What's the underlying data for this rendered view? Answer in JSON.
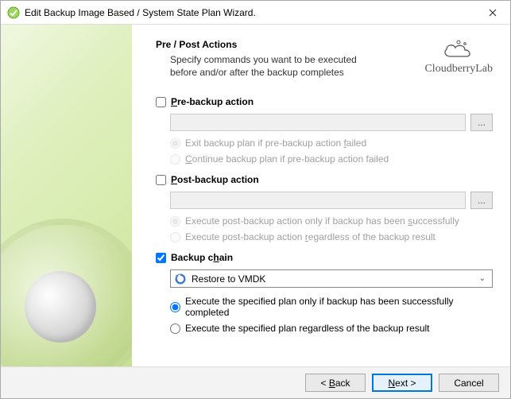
{
  "window": {
    "title": "Edit Backup Image Based / System State Plan Wizard."
  },
  "brand": "CloudberryLab",
  "header": {
    "title": "Pre / Post Actions",
    "subtitle": "Specify commands you want to be executed before and/or after the backup completes"
  },
  "prebackup": {
    "label_pre": "P",
    "label_post": "re-backup action",
    "exit_pre": "Exit backup plan if pre-backup action ",
    "exit_u": "f",
    "exit_post": "ailed",
    "cont_u": "C",
    "cont_post": "ontinue backup plan if pre-backup action failed",
    "browse": "..."
  },
  "postbackup": {
    "label_u": "P",
    "label_post": "ost-backup action",
    "succ_pre": "Execute post-backup action only if backup has been ",
    "succ_u": "s",
    "succ_post": "uccessfully",
    "always_pre": "Execute post-backup action ",
    "always_u": "r",
    "always_post": "egardless of the backup result",
    "browse": "..."
  },
  "chain": {
    "label_pre": "Backup c",
    "label_u": "h",
    "label_post": "ain",
    "selected": "Restore to VMDK",
    "opt1": "Execute the specified plan only if backup has been successfully completed",
    "opt2": "Execute the specified plan regardless of the backup result"
  },
  "buttons": {
    "back_lt": "< ",
    "back_u": "B",
    "back_post": "ack",
    "next_u": "N",
    "next_post": "ext >",
    "cancel": "Cancel"
  }
}
